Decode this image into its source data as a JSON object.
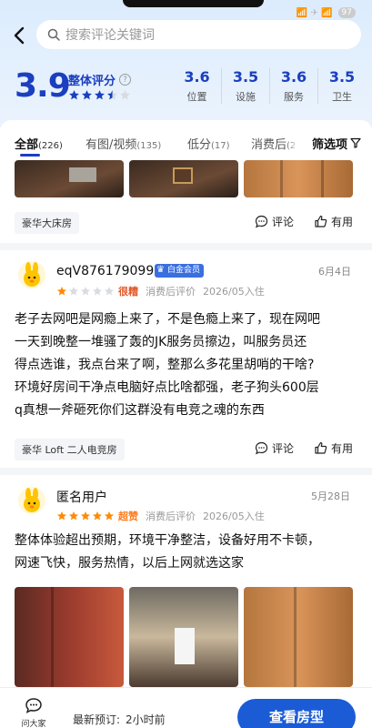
{
  "status_bar": {
    "right_text": "📶 ✈ 📶",
    "battery": "97"
  },
  "search": {
    "placeholder": "搜索评论关键词"
  },
  "rating": {
    "overall_score": "3.9",
    "overall_label": "整体评分",
    "help_icon": "?",
    "stars": 3.5,
    "sub_scores": [
      {
        "value": "3.6",
        "label": "位置"
      },
      {
        "value": "3.5",
        "label": "设施"
      },
      {
        "value": "3.6",
        "label": "服务"
      },
      {
        "value": "3.5",
        "label": "卫生"
      }
    ]
  },
  "tabs": [
    {
      "label": "全部",
      "count": "(226)"
    },
    {
      "label": "有图/视频",
      "count": "(135)"
    },
    {
      "label": "低分",
      "count": "(17)"
    },
    {
      "label": "消费后",
      "count": "(2"
    }
  ],
  "filter_label": "筛选项",
  "review0": {
    "room_tag": "豪华大床房",
    "comment_label": "评论",
    "like_label": "有用"
  },
  "review1": {
    "username": "eqV876179099",
    "member_badge": "白金会员",
    "date": "6月4日",
    "stars": 1,
    "rating_word": "很糟",
    "meta_1": "消费后评价",
    "meta_2": "2026/05入住",
    "lines": [
      "老子去网吧是网瘾上来了，不是色瘾上来了，现在网吧",
      "一天到晚整一堆骚了轰的JK服务员擦边，叫服务员还",
      "得点选谁，我点台来了啊，整那么多花里胡哨的干啥?",
      "环境好房间干净点电脑好点比啥都强，老子狗头600层",
      "q真想一斧砸死你们这群没有电竞之魂的东西"
    ],
    "room_tag": "豪华 Loft 二人电竞房",
    "comment_label": "评论",
    "like_label": "有用"
  },
  "review2": {
    "username": "匿名用户",
    "date": "5月28日",
    "stars": 5,
    "rating_word": "超赞",
    "meta_1": "消费后评价",
    "meta_2": "2026/05入住",
    "lines": [
      "整体体验超出预期，环境干净整洁，设备好用不卡顿，",
      "网速飞快，服务热情，以后上网就选这家"
    ]
  },
  "bottom": {
    "ask_label": "问大家",
    "latest_label": "最新预订:",
    "latest_value": "2小时前",
    "view_button": "查看房型"
  },
  "colors": {
    "accent": "#1b3fbf",
    "button": "#1b5cd6",
    "bad_rating": "#e05a2b",
    "good_rating": "#ff7a1a",
    "star_gold": "#ff8a00"
  }
}
